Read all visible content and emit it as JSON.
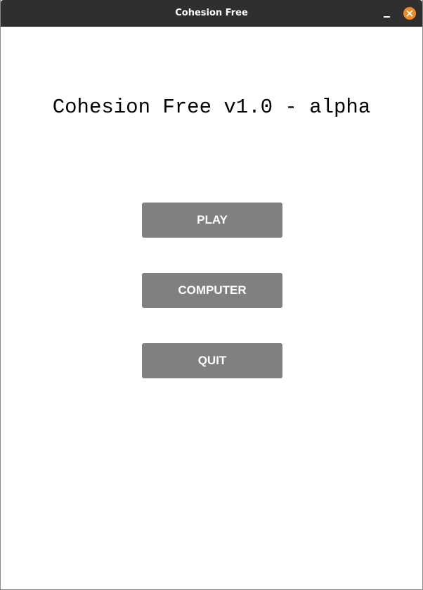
{
  "window": {
    "title": "Cohesion Free"
  },
  "main": {
    "heading": "Cohesion Free v1.0 - alpha",
    "buttons": {
      "play": "PLAY",
      "computer": "COMPUTER",
      "quit": "QUIT"
    }
  },
  "icons": {
    "minimize": "minimize-icon",
    "close": "close-icon"
  },
  "colors": {
    "titlebar": "#2f2f2f",
    "close_button": "#f08a24",
    "menu_button": "#808080",
    "background": "#ffffff"
  }
}
